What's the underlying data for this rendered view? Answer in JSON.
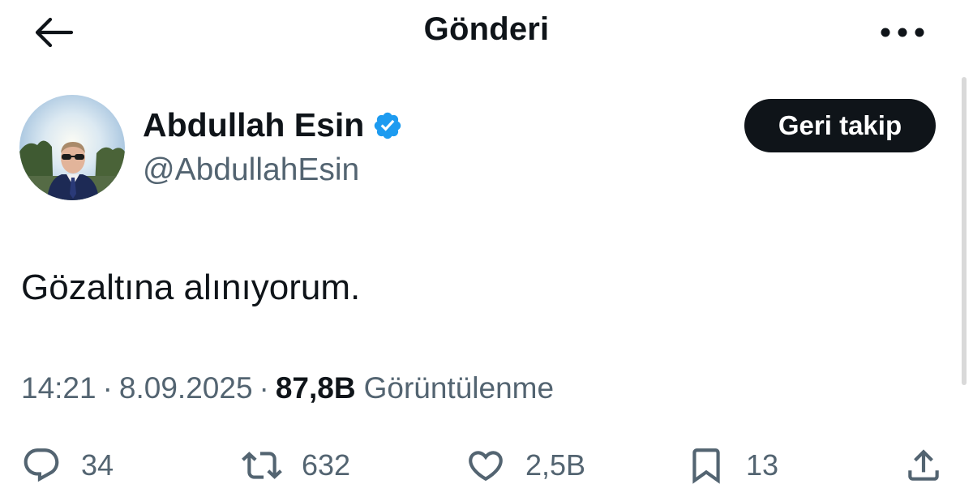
{
  "header": {
    "title": "Gönderi",
    "back_icon": "arrow-left-icon",
    "more_icon": "more-horizontal-icon"
  },
  "author": {
    "display_name": "Abdullah Esin",
    "handle": "@AbdullahEsin",
    "verified": true,
    "verified_color": "#1d9bf0"
  },
  "follow_button": {
    "label": "Geri takip"
  },
  "post": {
    "text": "Gözaltına alınıyorum.",
    "time": "14:21",
    "date": "8.09.2025",
    "separator": "·",
    "views_count": "87,8B",
    "views_label": "Görüntülenme"
  },
  "actions": {
    "replies": {
      "icon": "reply-icon",
      "count": "34"
    },
    "reposts": {
      "icon": "repost-icon",
      "count": "632"
    },
    "likes": {
      "icon": "heart-icon",
      "count": "2,5B"
    },
    "bookmarks": {
      "icon": "bookmark-icon",
      "count": "13"
    },
    "share": {
      "icon": "share-icon"
    }
  },
  "colors": {
    "text_primary": "#0f1419",
    "text_secondary": "#536471",
    "button_dark": "#0f1419",
    "accent": "#1d9bf0"
  }
}
